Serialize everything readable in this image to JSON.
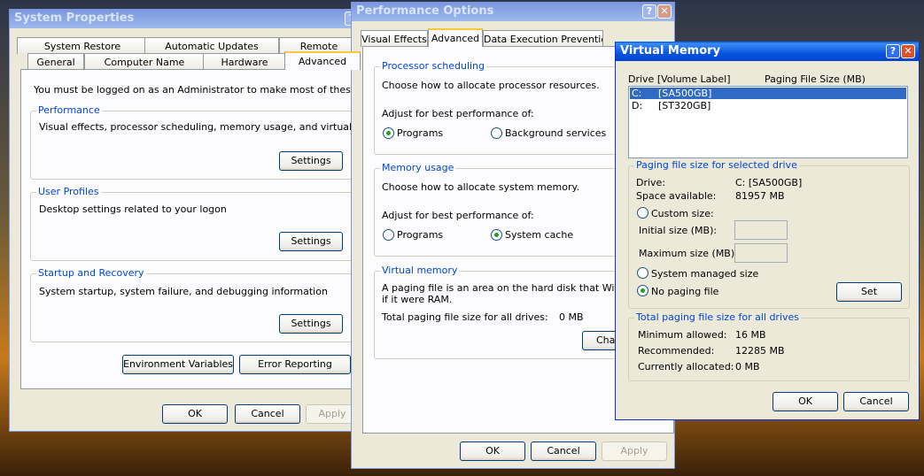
{
  "sysprops": {
    "title": "System Properties",
    "tabs_top": [
      "System Restore",
      "Automatic Updates",
      "Remote"
    ],
    "tabs_bottom": [
      "General",
      "Computer Name",
      "Hardware",
      "Advanced"
    ],
    "admin_note": "You must be logged on as an Administrator to make most of these changes.",
    "performance": {
      "label": "Performance",
      "desc": "Visual effects, processor scheduling, memory usage, and virtual memory",
      "button": "Settings"
    },
    "profiles": {
      "label": "User Profiles",
      "desc": "Desktop settings related to your logon",
      "button": "Settings"
    },
    "startup": {
      "label": "Startup and Recovery",
      "desc": "System startup, system failure, and debugging information",
      "button": "Settings"
    },
    "env_button": "Environment Variables",
    "error_button": "Error Reporting",
    "ok": "OK",
    "cancel": "Cancel",
    "apply": "Apply"
  },
  "perfopts": {
    "title": "Performance Options",
    "tabs": [
      "Visual Effects",
      "Advanced",
      "Data Execution Prevention"
    ],
    "proc": {
      "label": "Processor scheduling",
      "desc": "Choose how to allocate processor resources.",
      "adjust": "Adjust for best performance of:",
      "opt1": "Programs",
      "opt2": "Background services",
      "selected": "Programs"
    },
    "mem": {
      "label": "Memory usage",
      "desc": "Choose how to allocate system memory.",
      "adjust": "Adjust for best performance of:",
      "opt1": "Programs",
      "opt2": "System cache",
      "selected": "System cache"
    },
    "vm": {
      "label": "Virtual memory",
      "desc1": "A paging file is an area on the hard disk that Windows u",
      "desc2": "if it were RAM.",
      "total_label": "Total paging file size for all drives:",
      "total_value": "0 MB",
      "change": "Change"
    },
    "ok": "OK",
    "cancel": "Cancel",
    "apply": "Apply"
  },
  "vmem": {
    "title": "Virtual Memory",
    "col_drive": "Drive  [Volume Label]",
    "col_size": "Paging File Size (MB)",
    "drives": [
      {
        "letter": "C:",
        "label": "[SA500GB]",
        "selected": true
      },
      {
        "letter": "D:",
        "label": "[ST320GB]",
        "selected": false
      }
    ],
    "selected_group": {
      "label": "Paging file size for selected drive",
      "drive_label": "Drive:",
      "drive_value": "C:  [SA500GB]",
      "space_label": "Space available:",
      "space_value": "81957 MB",
      "custom": "Custom size:",
      "initial": "Initial size (MB):",
      "maximum": "Maximum size (MB):",
      "system_managed": "System managed size",
      "no_paging": "No paging file",
      "selected_option": "No paging file",
      "set": "Set"
    },
    "total_group": {
      "label": "Total paging file size for all drives",
      "min_label": "Minimum allowed:",
      "min_value": "16 MB",
      "rec_label": "Recommended:",
      "rec_value": "12285 MB",
      "cur_label": "Currently allocated:",
      "cur_value": "0 MB"
    },
    "ok": "OK",
    "cancel": "Cancel"
  }
}
